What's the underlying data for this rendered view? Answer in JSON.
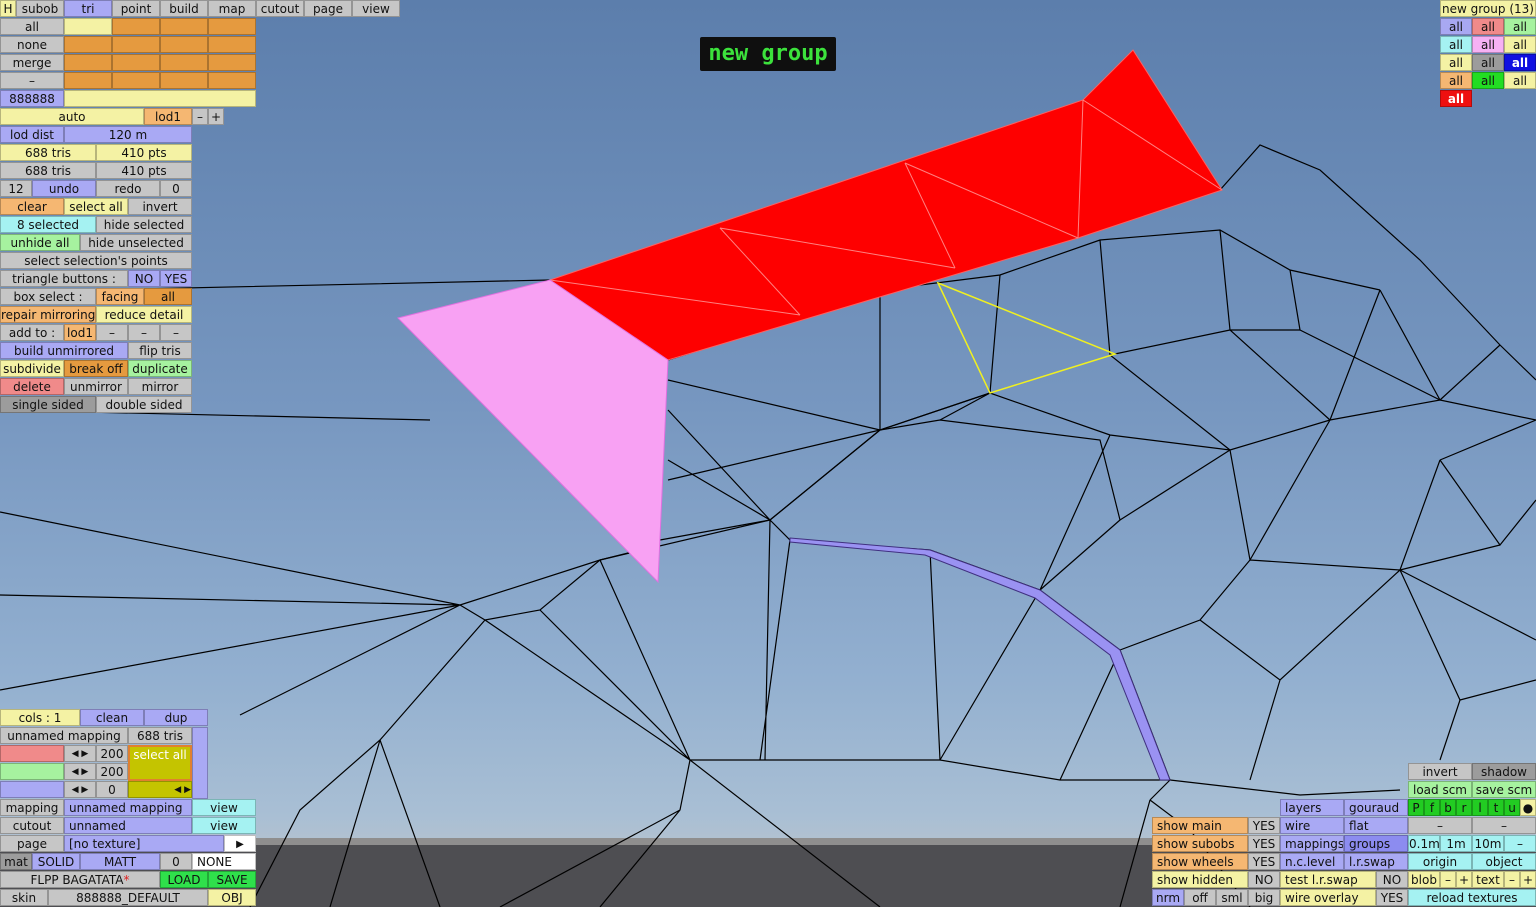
{
  "banner": "new group",
  "top_tabs": [
    "H",
    "subob",
    "tri",
    "point",
    "build",
    "map",
    "cutout",
    "page",
    "view"
  ],
  "select_rows": [
    "all",
    "none",
    "merge",
    "–"
  ],
  "color_code": "888888",
  "lod": {
    "auto": "auto",
    "lod": "lod1",
    "minus": "–",
    "plus": "+",
    "dist_label": "lod dist",
    "dist_value": "120 m"
  },
  "stats": {
    "tris_a": "688 tris",
    "pts_a": "410 pts",
    "tris_b": "688 tris",
    "pts_b": "410 pts"
  },
  "history": {
    "undo_count": "12",
    "undo": "undo",
    "redo": "redo",
    "redo_count": "0"
  },
  "actions": {
    "clear": "clear",
    "select_all": "select all",
    "invert": "invert",
    "selected": "8 selected",
    "hide_selected": "hide selected",
    "unhide_all": "unhide all",
    "hide_unselected": "hide unselected",
    "select_points": "select selection's points",
    "tri_buttons": "triangle buttons :",
    "no": "NO",
    "yes": "YES",
    "box_select": "box select :",
    "facing": "facing",
    "all": "all",
    "repair": "repair mirroring",
    "reduce": "reduce detail",
    "add_to": "add to :",
    "add_lod": "lod1",
    "d1": "–",
    "d2": "–",
    "d3": "–",
    "build_unmirrored": "build unmirrored",
    "flip_tris": "flip tris",
    "subdivide": "subdivide",
    "break_off": "break off",
    "duplicate": "duplicate",
    "delete": "delete",
    "unmirror": "unmirror",
    "mirror": "mirror",
    "single_sided": "single sided",
    "double_sided": "double sided"
  },
  "group_panel": {
    "title": "new group (13)",
    "rows": [
      [
        "all",
        "all",
        "all"
      ],
      [
        "all",
        "all",
        "all"
      ],
      [
        "all",
        "all",
        "all"
      ],
      [
        "all",
        "all",
        "all"
      ],
      [
        "all"
      ]
    ],
    "colors": [
      [
        "#a8a8f2",
        "#f08a8a",
        "#a6f29f"
      ],
      [
        "#a5f2f2",
        "#f6b1f4",
        "#f4f2a4"
      ],
      [
        "#f4f2a4",
        "#9c9c9c",
        "#1010e0"
      ],
      [
        "#f5b772",
        "#22dd22",
        "#f4f2a4"
      ],
      [
        "#ee1010"
      ]
    ]
  },
  "mapping": {
    "cols": "cols : 1",
    "clean": "clean",
    "dup": "dup",
    "name": "unnamed mapping",
    "tris": "688 tris",
    "v1": "200",
    "v2": "200",
    "v3": "0",
    "select_all": "select all",
    "mapping_label": "mapping",
    "mapping_value": "unnamed mapping",
    "view1": "view",
    "cutout_label": "cutout",
    "cutout_value": "unnamed",
    "view2": "view",
    "page_label": "page",
    "page_value": "[no texture]",
    "arrow": "▶",
    "mat": "mat",
    "solid": "SOLID",
    "matt": "MATT",
    "mat_num": "0",
    "none": "NONE",
    "car": "FLPP BAGATATA",
    "star": "*",
    "load": "LOAD",
    "save": "SAVE",
    "skin": "skin",
    "skin_value": "888888_DEFAULT",
    "obj": "OBJ"
  },
  "display": {
    "show_main": "show main",
    "show_main_v": "YES",
    "show_subobs": "show subobs",
    "show_subobs_v": "YES",
    "show_wheels": "show wheels",
    "show_wheels_v": "YES",
    "show_hidden": "show hidden",
    "show_hidden_v": "NO",
    "nrm": "nrm",
    "off": "off",
    "sml": "sml",
    "big": "big",
    "layers": "layers",
    "gouraud": "gouraud",
    "wire": "wire",
    "flat": "flat",
    "mappings": "mappings",
    "groups": "groups",
    "nclevel": "n.c.level",
    "lrswap": "l.r.swap",
    "test": "test l.r.swap",
    "test_v": "NO",
    "overlay": "wire overlay",
    "overlay_v": "YES"
  },
  "scene": {
    "invert": "invert",
    "shadow": "shadow",
    "load_scm": "load scm",
    "save_scm": "save scm",
    "keys": [
      "P",
      "f",
      "b",
      "r",
      "l",
      "t",
      "u",
      "●"
    ],
    "dash1": "–",
    "dash2": "–",
    "s1": "0.1m",
    "s2": "1m",
    "s3": "10m",
    "s4": "–",
    "origin": "origin",
    "object": "object",
    "blob": "blob",
    "bm": "–",
    "bp": "+",
    "text": "text",
    "tm": "–",
    "tp": "+",
    "reload": "reload textures"
  }
}
